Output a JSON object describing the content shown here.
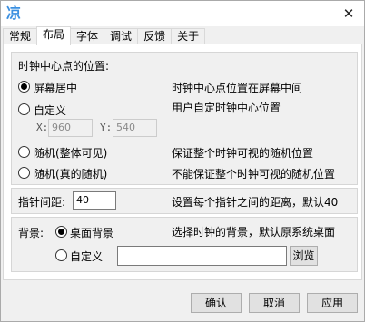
{
  "window": {
    "icon_glyph": "凉",
    "close_glyph": "✕"
  },
  "tabs": [
    {
      "label": "常规",
      "active": false
    },
    {
      "label": "布局",
      "active": true
    },
    {
      "label": "字体",
      "active": false
    },
    {
      "label": "调试",
      "active": false
    },
    {
      "label": "反馈",
      "active": false
    },
    {
      "label": "关于",
      "active": false
    }
  ],
  "position": {
    "heading": "时钟中心点的位置:",
    "options": [
      {
        "label": "屏幕居中",
        "description": "时钟中心点位置在屏幕中间",
        "checked": true
      },
      {
        "label": "自定义",
        "description": "用户自定时钟中心位置",
        "checked": false
      },
      {
        "label": "随机(整体可见)",
        "description": "保证整个时钟可视的随机位置",
        "checked": false
      },
      {
        "label": "随机(真的随机)",
        "description": "不能保证整个时钟可视的随机位置",
        "checked": false
      }
    ],
    "x_label": "X:",
    "x_value": "960",
    "y_label": "Y:",
    "y_value": "540"
  },
  "spacing": {
    "label": "指针间距:",
    "value": "40",
    "description": "设置每个指针之间的距离，默认40"
  },
  "background": {
    "label": "背景:",
    "options": [
      {
        "label": "桌面背景",
        "checked": true
      },
      {
        "label": "自定义",
        "checked": false
      }
    ],
    "description": "选择时钟的背景，默认原系统桌面",
    "path_value": "",
    "browse_label": "浏览"
  },
  "footer": {
    "ok_label": "确认",
    "cancel_label": "取消",
    "apply_label": "应用"
  }
}
